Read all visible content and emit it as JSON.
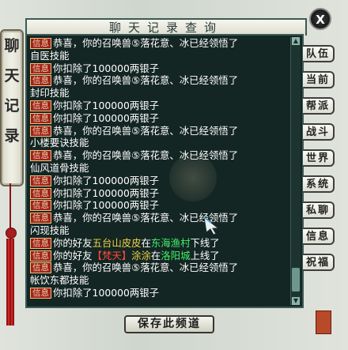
{
  "window": {
    "title": "聊天记录查询",
    "close_label": "X",
    "side_title": [
      "聊",
      "天",
      "记",
      "录"
    ],
    "save_button": "保存此频道"
  },
  "tabs": [
    "队伍",
    "当前",
    "帮派",
    "战斗",
    "世界",
    "系统",
    "私聊",
    "信息",
    "祝福"
  ],
  "chat": {
    "tag_label": "信息",
    "lines": [
      {
        "tag": true,
        "parts": [
          {
            "text": "恭喜，你的召唤兽⑤落花意、冰已经领悟了",
            "color": "white"
          }
        ]
      },
      {
        "tag": false,
        "parts": [
          {
            "text": "自医技能",
            "color": "white"
          }
        ]
      },
      {
        "tag": true,
        "parts": [
          {
            "text": "你扣除了100000两银子",
            "color": "white"
          }
        ]
      },
      {
        "tag": true,
        "parts": [
          {
            "text": "恭喜，你的召唤兽⑤落花意、冰已经领悟了",
            "color": "white"
          }
        ]
      },
      {
        "tag": false,
        "parts": [
          {
            "text": "封印技能",
            "color": "white"
          }
        ]
      },
      {
        "tag": true,
        "parts": [
          {
            "text": "你扣除了100000两银子",
            "color": "white"
          }
        ]
      },
      {
        "tag": true,
        "parts": [
          {
            "text": "你扣除了100000两银子",
            "color": "white"
          }
        ]
      },
      {
        "tag": true,
        "parts": [
          {
            "text": "恭喜，你的召唤兽⑤落花意、冰已经领悟了",
            "color": "white"
          }
        ]
      },
      {
        "tag": false,
        "parts": [
          {
            "text": "小楼要诀技能",
            "color": "white"
          }
        ]
      },
      {
        "tag": true,
        "parts": [
          {
            "text": "恭喜，你的召唤兽⑤落花意、冰已经领悟了",
            "color": "white"
          }
        ]
      },
      {
        "tag": false,
        "parts": [
          {
            "text": "仙风道骨技能",
            "color": "white"
          }
        ]
      },
      {
        "tag": true,
        "parts": [
          {
            "text": "你扣除了100000两银子",
            "color": "white"
          }
        ]
      },
      {
        "tag": true,
        "parts": [
          {
            "text": "你扣除了100000两银子",
            "color": "white"
          }
        ]
      },
      {
        "tag": true,
        "parts": [
          {
            "text": "你扣除了100000两银子",
            "color": "white"
          }
        ]
      },
      {
        "tag": true,
        "parts": [
          {
            "text": "恭喜，你的召唤兽⑤落花意、冰已经领悟了",
            "color": "white"
          }
        ]
      },
      {
        "tag": false,
        "parts": [
          {
            "text": "闪现技能",
            "color": "white"
          }
        ]
      },
      {
        "tag": true,
        "parts": [
          {
            "text": "你的好友",
            "color": "white"
          },
          {
            "text": "五台山皮皮",
            "color": "gold"
          },
          {
            "text": "在",
            "color": "white"
          },
          {
            "text": "东海渔村",
            "color": "green"
          },
          {
            "text": "下线了",
            "color": "white"
          }
        ]
      },
      {
        "tag": true,
        "parts": [
          {
            "text": "你的好友",
            "color": "white"
          },
          {
            "text": "【梵天】",
            "color": "red"
          },
          {
            "text": "涂涂",
            "color": "gold"
          },
          {
            "text": "在",
            "color": "white"
          },
          {
            "text": "洛阳城",
            "color": "green"
          },
          {
            "text": "上线了",
            "color": "white"
          }
        ]
      },
      {
        "tag": true,
        "parts": [
          {
            "text": "恭喜，你的召唤兽⑤落花意、冰已经领悟了",
            "color": "white"
          }
        ]
      },
      {
        "tag": false,
        "parts": [
          {
            "text": "帐饮东都技能",
            "color": "white"
          }
        ]
      },
      {
        "tag": true,
        "parts": [
          {
            "text": "你扣除了100000两银子",
            "color": "white"
          }
        ]
      }
    ]
  }
}
